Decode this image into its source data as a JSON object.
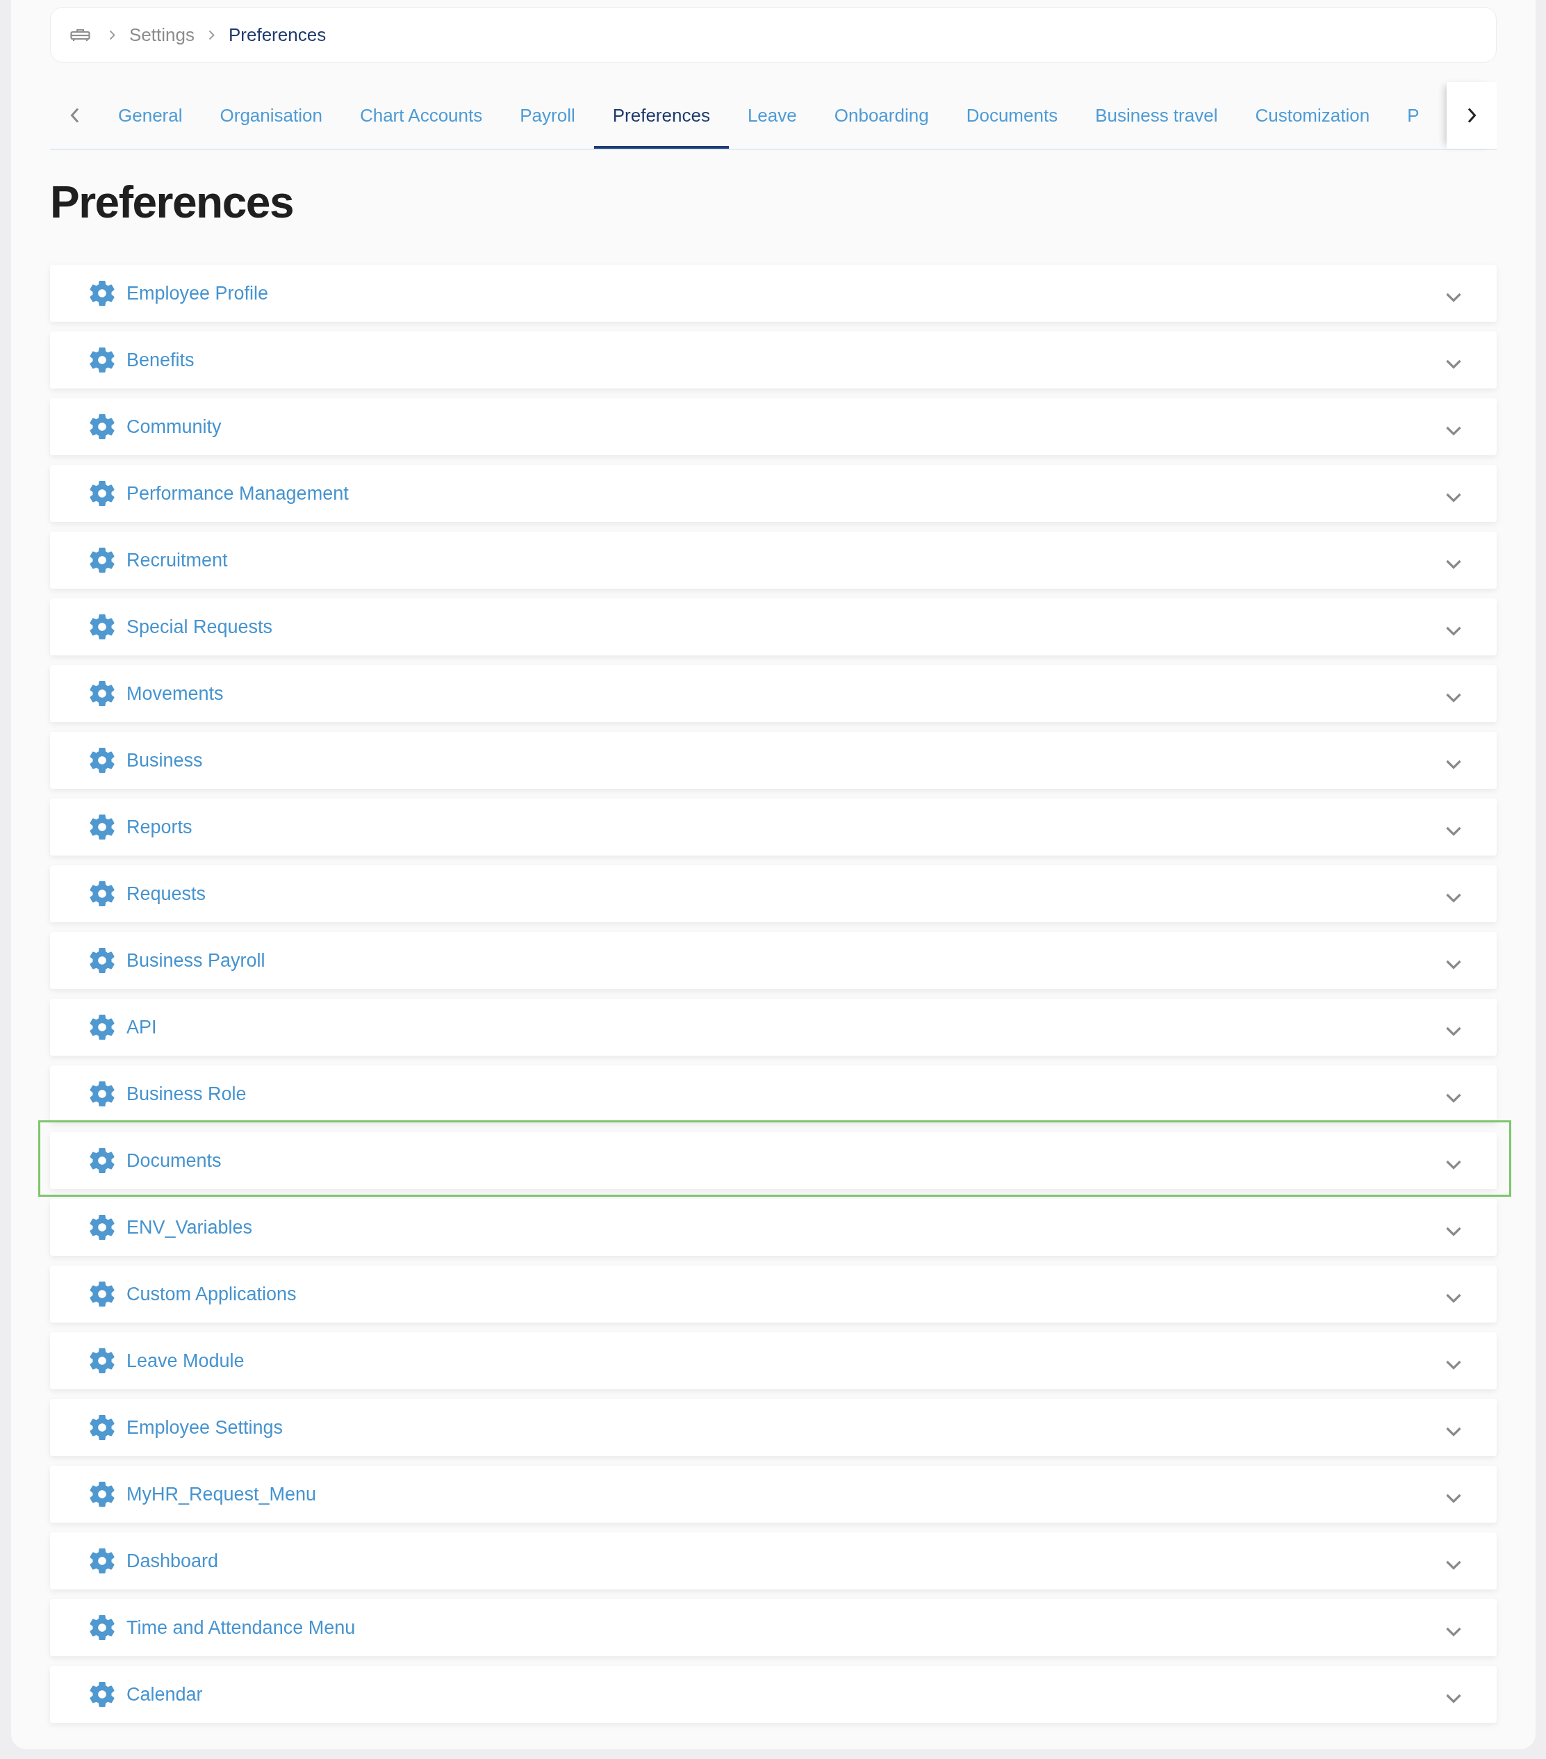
{
  "breadcrumb": {
    "items": [
      {
        "label": "Settings",
        "current": false
      },
      {
        "label": "Preferences",
        "current": true
      }
    ]
  },
  "tab_scroll": [
    {
      "kind": "left",
      "disabled": true
    },
    {
      "kind": "right",
      "disabled": false
    }
  ],
  "tabs": [
    {
      "label": "General",
      "selected": false
    },
    {
      "label": "Organisation",
      "selected": false
    },
    {
      "label": "Chart Accounts",
      "selected": false
    },
    {
      "label": "Payroll",
      "selected": false
    },
    {
      "label": "Preferences",
      "selected": true
    },
    {
      "label": "Leave",
      "selected": false
    },
    {
      "label": "Onboarding",
      "selected": false
    },
    {
      "label": "Documents",
      "selected": false
    },
    {
      "label": "Business travel",
      "selected": false
    },
    {
      "label": "Customization",
      "selected": false
    },
    {
      "label": "P",
      "selected": false
    }
  ],
  "heading": "Preferences",
  "sections": [
    {
      "label": "Employee Profile",
      "expanded": false,
      "highlighted": false
    },
    {
      "label": "Benefits",
      "expanded": false,
      "highlighted": false
    },
    {
      "label": "Community",
      "expanded": false,
      "highlighted": false
    },
    {
      "label": "Performance Management",
      "expanded": false,
      "highlighted": false
    },
    {
      "label": "Recruitment",
      "expanded": false,
      "highlighted": false
    },
    {
      "label": "Special Requests",
      "expanded": false,
      "highlighted": false
    },
    {
      "label": "Movements",
      "expanded": false,
      "highlighted": false
    },
    {
      "label": "Business",
      "expanded": false,
      "highlighted": false
    },
    {
      "label": "Reports",
      "expanded": false,
      "highlighted": false
    },
    {
      "label": "Requests",
      "expanded": false,
      "highlighted": false
    },
    {
      "label": "Business Payroll",
      "expanded": false,
      "highlighted": false
    },
    {
      "label": "API",
      "expanded": false,
      "highlighted": false
    },
    {
      "label": "Business Role",
      "expanded": false,
      "highlighted": false
    },
    {
      "label": "Documents",
      "expanded": false,
      "highlighted": true
    },
    {
      "label": "ENV_Variables",
      "expanded": false,
      "highlighted": false
    },
    {
      "label": "Custom Applications",
      "expanded": false,
      "highlighted": false
    },
    {
      "label": "Leave Module",
      "expanded": false,
      "highlighted": false
    },
    {
      "label": "Employee Settings",
      "expanded": false,
      "highlighted": false
    },
    {
      "label": "MyHR_Request_Menu",
      "expanded": false,
      "highlighted": false
    },
    {
      "label": "Dashboard",
      "expanded": false,
      "highlighted": false
    },
    {
      "label": "Time and Attendance Menu",
      "expanded": false,
      "highlighted": false
    },
    {
      "label": "Calendar",
      "expanded": false,
      "highlighted": false
    }
  ]
}
